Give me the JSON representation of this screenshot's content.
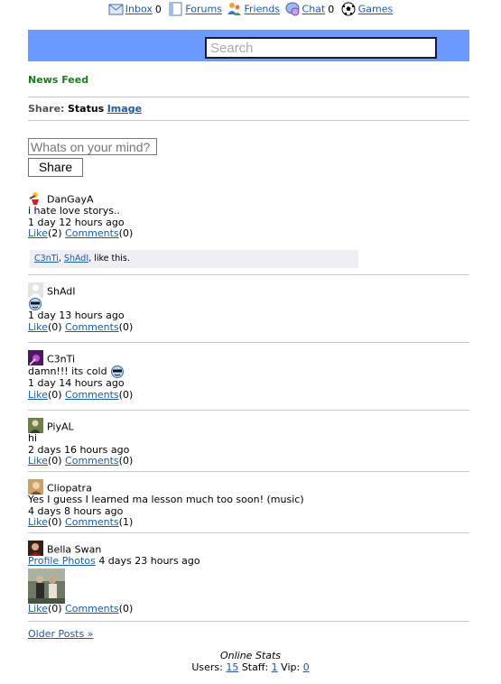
{
  "nav": {
    "inbox": {
      "label": "Inbox",
      "count": "0"
    },
    "forums": {
      "label": "Forums"
    },
    "friends": {
      "label": "Friends"
    },
    "chat": {
      "label": "Chat",
      "count": "0"
    },
    "games": {
      "label": "Games"
    }
  },
  "search": {
    "placeholder": "Search"
  },
  "news_feed": "News Feed",
  "share_bar": {
    "share": "Share:",
    "status": "Status",
    "image": "Image"
  },
  "composer": {
    "placeholder": "Whats on your mind?",
    "button": "Share"
  },
  "posts": [
    {
      "user": "DanGayA",
      "text": "i hate love storys..",
      "time": "1 day 12 hours ago",
      "like": "Like",
      "like_count": "(2)",
      "comments": "Comments",
      "comment_count": "(0)",
      "liked_by": [
        "C3nTi",
        "ShAdI"
      ],
      "liked_by_sep": ",",
      "liked_suffix": ", like this."
    },
    {
      "user": "ShAdI",
      "text": "",
      "emoji": "cool-face",
      "time": "1 day 13 hours ago",
      "like": "Like",
      "like_count": "(0)",
      "comments": "Comments",
      "comment_count": "(0)"
    },
    {
      "user": "C3nTi",
      "text": "damn!!! its cold",
      "emoji": "cool-face",
      "time": "1 day 14 hours ago",
      "like": "Like",
      "like_count": "(0)",
      "comments": "Comments",
      "comment_count": "(0)"
    },
    {
      "user": "PiyAL",
      "text": "hi",
      "time": "2 days 16 hours ago",
      "like": "Like",
      "like_count": "(0)",
      "comments": "Comments",
      "comment_count": "(0)"
    },
    {
      "user": "Cliopatra",
      "text": "Yes I guess I learned ma lesson much too soon! (music)",
      "time": "4 days 8 hours ago",
      "like": "Like",
      "like_count": "(0)",
      "comments": "Comments",
      "comment_count": "(1)"
    },
    {
      "user": "Bella Swan",
      "link": "Profile Photos",
      "time": "4 days 23 hours ago",
      "like": "Like",
      "like_count": "(0)",
      "comments": "Comments",
      "comment_count": "(0)"
    }
  ],
  "older_posts": "Older Posts »",
  "stats": {
    "title": "Online Stats",
    "users_label": "Users:",
    "users": "15",
    "staff_label": "Staff:",
    "staff": "1",
    "vip_label": "Vip:",
    "vip": "0"
  },
  "colors": {
    "bluebar": "#6b9bff",
    "news_feed": "#1b7a1b",
    "link": "#1f5a9e"
  }
}
